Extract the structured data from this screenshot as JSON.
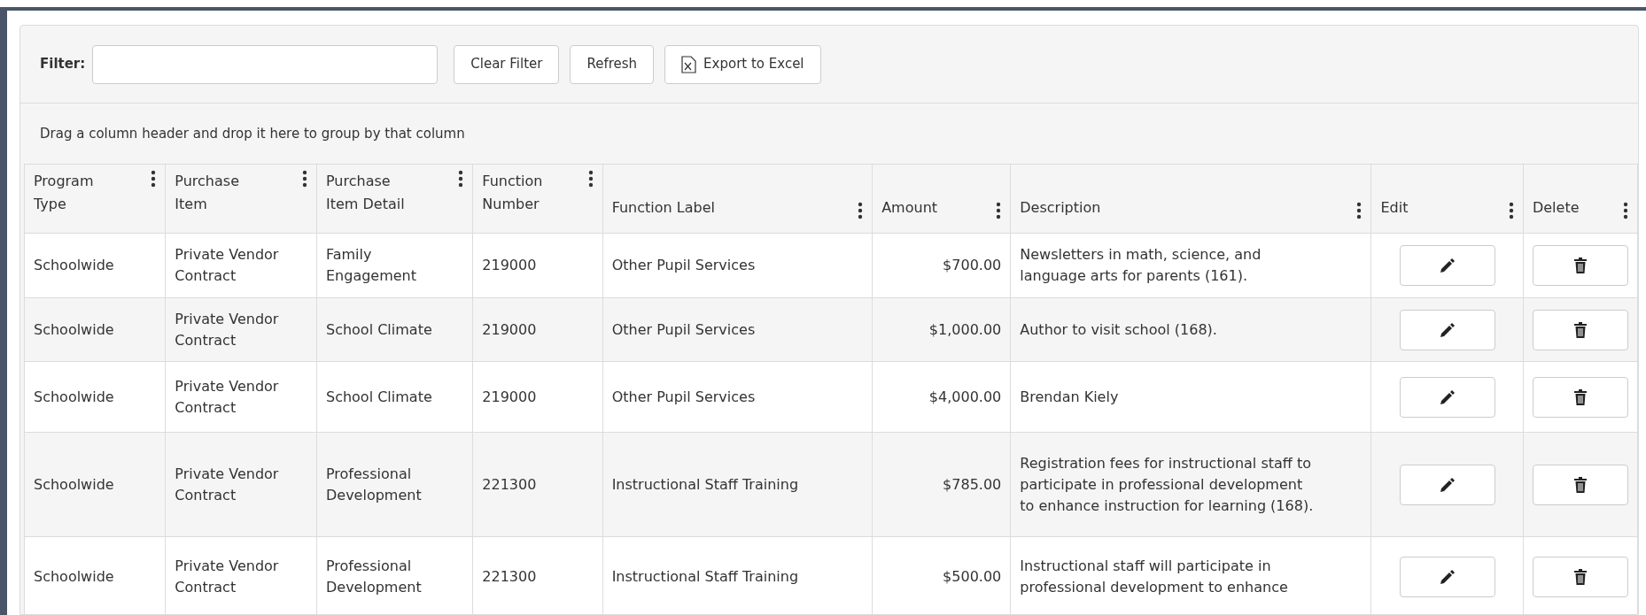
{
  "toolbar": {
    "filter_label": "Filter:",
    "buttons": [
      {
        "kind": "plain",
        "label": "Clear Filter"
      },
      {
        "kind": "plain",
        "label": "Refresh"
      },
      {
        "kind": "excel",
        "label": "Export to Excel"
      }
    ]
  },
  "group_hint": "Drag a column header and drop it here to group by that column",
  "table": {
    "columns": [
      {
        "label": "Program Type",
        "kind": "text"
      },
      {
        "label": "Purchase Item",
        "kind": "text"
      },
      {
        "label": "Purchase Item Detail",
        "kind": "text"
      },
      {
        "label": "Function Number",
        "kind": "text"
      },
      {
        "label": "Function Label",
        "kind": "text"
      },
      {
        "label": "Amount",
        "kind": "money"
      },
      {
        "label": "Description",
        "kind": "text"
      },
      {
        "label": "Edit",
        "kind": "edit"
      },
      {
        "label": "Delete",
        "kind": "delete"
      }
    ],
    "rows": [
      {
        "cells": [
          "Schoolwide",
          "Private Vendor Contract",
          "Family Engagement",
          "219000",
          "Other Pupil Services",
          "$700.00",
          "Newsletters in math, science, and language arts for parents (161)."
        ]
      },
      {
        "cells": [
          "Schoolwide",
          "Private Vendor Contract",
          "School Climate",
          "219000",
          "Other Pupil Services",
          "$1,000.00",
          "Author to visit school (168)."
        ]
      },
      {
        "cells": [
          "Schoolwide",
          "Private Vendor Contract",
          "School Climate",
          "219000",
          "Other Pupil Services",
          "$4,000.00",
          "Brendan Kiely"
        ]
      },
      {
        "cells": [
          "Schoolwide",
          "Private Vendor Contract",
          "Professional Development",
          "221300",
          "Instructional Staff Training",
          "$785.00",
          "Registration fees for instructional staff to participate in professional development to enhance instruction for learning (168)."
        ]
      },
      {
        "cells": [
          "Schoolwide",
          "Private Vendor Contract",
          "Professional Development",
          "221300",
          "Instructional Staff Training",
          "$500.00",
          "Instructional staff will participate in professional development to enhance"
        ]
      }
    ]
  }
}
